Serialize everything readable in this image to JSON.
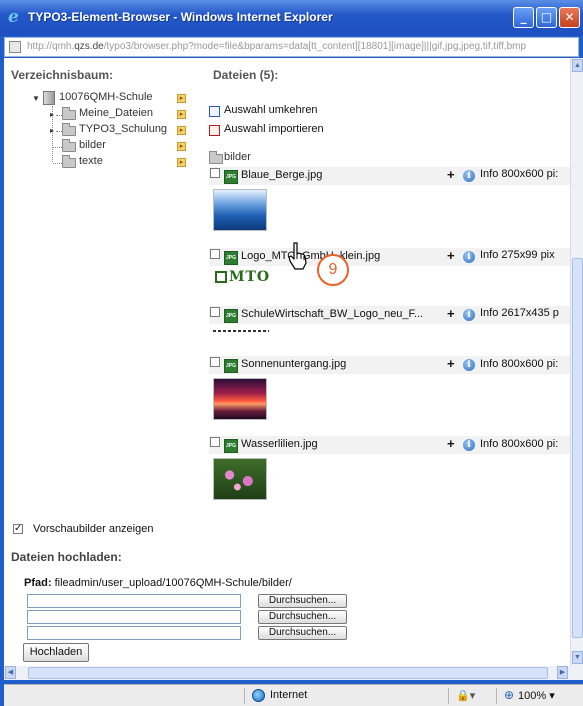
{
  "window": {
    "title": "TYPO3-Element-Browser - Windows Internet Explorer",
    "buttons": {
      "minimize": "_",
      "maximize": "□",
      "close": "✕"
    }
  },
  "addressbar": {
    "url_prefix": "http://qmh.",
    "url_domain": "qzs.de",
    "url_rest": "/typo3/browser.php?mode=file&bparams=data[tt_content][18801][image]|||gif,jpg,jpeg,tif,tiff,bmp"
  },
  "tree": {
    "heading": "Verzeichnisbaum:",
    "root": "10076QMH-Schule",
    "items": [
      "Meine_Dateien",
      "TYPO3_Schulung",
      "bilder",
      "texte"
    ]
  },
  "files": {
    "heading": "Dateien (5):",
    "actions": {
      "invert": "Auswahl umkehren",
      "import": "Auswahl importieren"
    },
    "folder": "bilder",
    "rows": [
      {
        "name": "Blaue_Berge.jpg",
        "info": "Info",
        "size": "800x600 pi:"
      },
      {
        "name": "Logo_MTO_GmbH_klein.jpg",
        "info": "Info",
        "size": "275x99 pix"
      },
      {
        "name": "SchuleWirtschaft_BW_Logo_neu_F...",
        "info": "Info",
        "size": "2617x435 p"
      },
      {
        "name": "Sonnenuntergang.jpg",
        "info": "Info",
        "size": "800x600 pi:"
      },
      {
        "name": "Wasserlilien.jpg",
        "info": "Info",
        "size": "800x600 pi:"
      }
    ],
    "thumb_text": {
      "mto": "MTO"
    }
  },
  "annotation": {
    "step": "9"
  },
  "preview": {
    "label": "Vorschaubilder anzeigen",
    "checked": true,
    "mark": "✓"
  },
  "upload": {
    "heading": "Dateien hochladen:",
    "path_label": "Pfad:",
    "path_value": "fileadmin/user_upload/10076QMH-Schule/bilder/",
    "browse_label": "Durchsuchen...",
    "submit_label": "Hochladen"
  },
  "statusbar": {
    "zone": "Internet",
    "security": "🔒▾",
    "zoom": "100%",
    "zoom_arrow": "▾"
  },
  "colors": {
    "titlebar": "#2458c8",
    "accent": "#e8622a"
  }
}
